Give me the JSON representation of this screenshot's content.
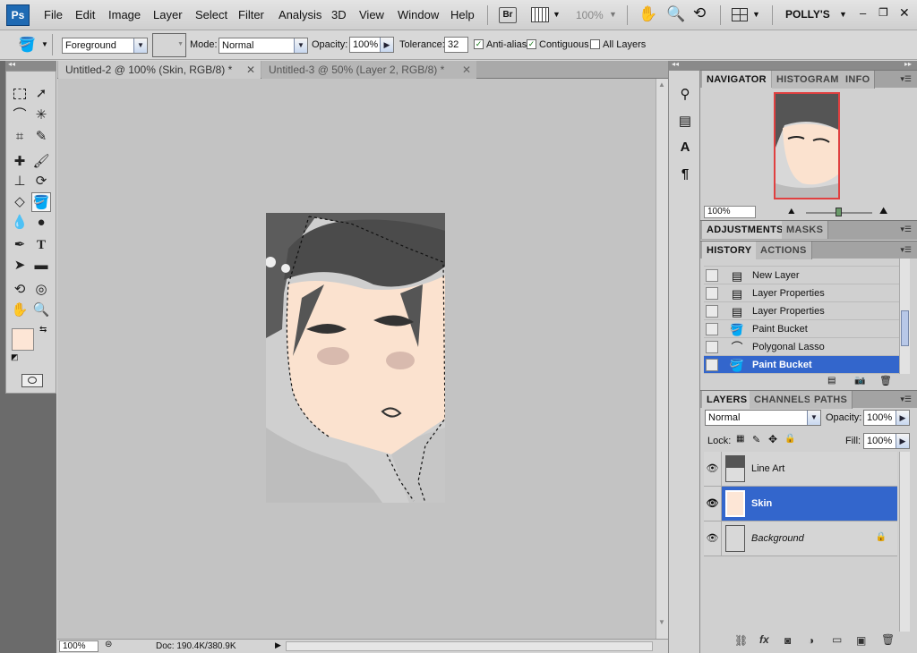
{
  "app": {
    "logo": "Ps",
    "workspace": "POLLY'S"
  },
  "menus": [
    "File",
    "Edit",
    "Image",
    "Layer",
    "Select",
    "Filter",
    "Analysis",
    "3D",
    "View",
    "Window",
    "Help"
  ],
  "menubar": {
    "bridge": "Br",
    "zoom": "100%"
  },
  "options": {
    "fill_source": "Foreground",
    "mode_label": "Mode:",
    "mode": "Normal",
    "opacity_label": "Opacity:",
    "opacity": "100%",
    "tolerance_label": "Tolerance:",
    "tolerance": "32",
    "antialias": "Anti-alias",
    "contiguous": "Contiguous",
    "all_layers": "All Layers",
    "antialias_checked": true,
    "contiguous_checked": true,
    "all_layers_checked": false
  },
  "tabs": [
    {
      "label": "Untitled-2 @ 100% (Skin, RGB/8) *",
      "active": true
    },
    {
      "label": "Untitled-3 @ 50% (Layer 2, RGB/8) *",
      "active": false
    }
  ],
  "status": {
    "zoom": "100%",
    "doc": "Doc: 190.4K/380.9K"
  },
  "colors": {
    "foreground": "#fde6d6",
    "background": "#ffffff",
    "selection": "#3366cc",
    "canvas": "#c3c3c3"
  },
  "navigator": {
    "tabs": [
      "NAVIGATOR",
      "HISTOGRAM",
      "INFO"
    ],
    "zoom": "100%"
  },
  "adjustments": {
    "tabs": [
      "ADJUSTMENTS",
      "MASKS"
    ]
  },
  "history": {
    "tabs": [
      "HISTORY",
      "ACTIONS"
    ],
    "items": [
      {
        "label": "New Layer",
        "icon": "document-icon"
      },
      {
        "label": "Layer Properties",
        "icon": "document-icon"
      },
      {
        "label": "Layer Properties",
        "icon": "document-icon"
      },
      {
        "label": "Paint Bucket",
        "icon": "paint-bucket-icon"
      },
      {
        "label": "Polygonal Lasso",
        "icon": "lasso-icon"
      },
      {
        "label": "Paint Bucket",
        "icon": "paint-bucket-icon",
        "selected": true
      }
    ]
  },
  "layers": {
    "tabs": [
      "LAYERS",
      "CHANNELS",
      "PATHS"
    ],
    "blend": "Normal",
    "opacity_label": "Opacity:",
    "opacity": "100%",
    "lock_label": "Lock:",
    "fill_label": "Fill:",
    "fill": "100%",
    "items": [
      {
        "name": "Line Art"
      },
      {
        "name": "Skin",
        "selected": true
      },
      {
        "name": "Background",
        "locked": true
      }
    ]
  }
}
